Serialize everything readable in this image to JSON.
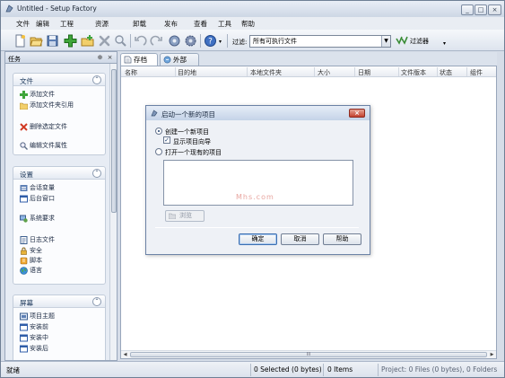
{
  "window": {
    "title": "Untitled - Setup Factory",
    "controls": [
      "_",
      "□",
      "×"
    ]
  },
  "menu": [
    "文件",
    "编辑",
    "工程",
    "资源",
    "卸载",
    "发布",
    "查看",
    "工具",
    "帮助"
  ],
  "toolbar": {
    "icons": [
      "new-icon",
      "open-icon",
      "save-icon",
      "add-icon",
      "add-folder-icon",
      "delete-icon",
      "search-icon",
      "undo-icon",
      "redo-icon",
      "build-icon",
      "settings-icon",
      "help-icon"
    ],
    "filter_label": "过滤:",
    "filter_value": "所有可执行文件",
    "filter_button": "过滤器"
  },
  "tasks_pane": {
    "title": "任务",
    "groups": [
      {
        "title": "文件",
        "items": [
          {
            "label": "添加文件",
            "icon": "add-icon"
          },
          {
            "label": "添加文件夹引用",
            "icon": "folder-icon"
          },
          {
            "label": "删除选定文件",
            "icon": "delete-icon"
          },
          {
            "label": "编辑文件属性",
            "icon": "search-icon"
          }
        ]
      },
      {
        "title": "设置",
        "items": [
          {
            "label": "会话变量",
            "icon": "variables-icon"
          },
          {
            "label": "后台窗口",
            "icon": "window-icon"
          },
          {
            "label": "系统要求",
            "icon": "system-icon"
          },
          {
            "label": "日志文件",
            "icon": "log-icon"
          },
          {
            "label": "安全",
            "icon": "lock-icon"
          },
          {
            "label": "脚本",
            "icon": "script-icon"
          },
          {
            "label": "语言",
            "icon": "globe-icon"
          }
        ]
      },
      {
        "title": "屏幕",
        "items": [
          {
            "label": "项目主题",
            "icon": "theme-icon"
          },
          {
            "label": "安装前",
            "icon": "screen-icon"
          },
          {
            "label": "安装中",
            "icon": "screen-icon"
          },
          {
            "label": "安装后",
            "icon": "screen-icon"
          }
        ]
      }
    ]
  },
  "tabs": [
    {
      "label": "存档",
      "icon": "archive-icon",
      "active": true
    },
    {
      "label": "外部",
      "icon": "external-icon",
      "active": false
    }
  ],
  "file_list": {
    "columns": [
      "名称",
      "目的地",
      "本地文件夹",
      "大小",
      "日期",
      "文件版本",
      "状态",
      "组件"
    ],
    "rows": [],
    "hscroll_grip": "III"
  },
  "status_bar": {
    "ready": "就绪",
    "selected": "0 Selected (0 bytes)",
    "items": "0 Items",
    "project": "Project: 0 Files (0 bytes), 0 Folders"
  },
  "dialog": {
    "title": "启动一个新的项目",
    "option_new": "创建一个新项目",
    "option_wizard": "显示项目向导",
    "option_open": "打开一个现有的项目",
    "watermark": "Mhs.com",
    "browse": "浏览",
    "ok": "确定",
    "cancel": "取消",
    "help": "帮助"
  },
  "colors": {
    "chrome": "#d6dde8",
    "titlebar": "#cdd7e5",
    "dialog_close": "#c4412e",
    "group_title": "#1e395b"
  }
}
